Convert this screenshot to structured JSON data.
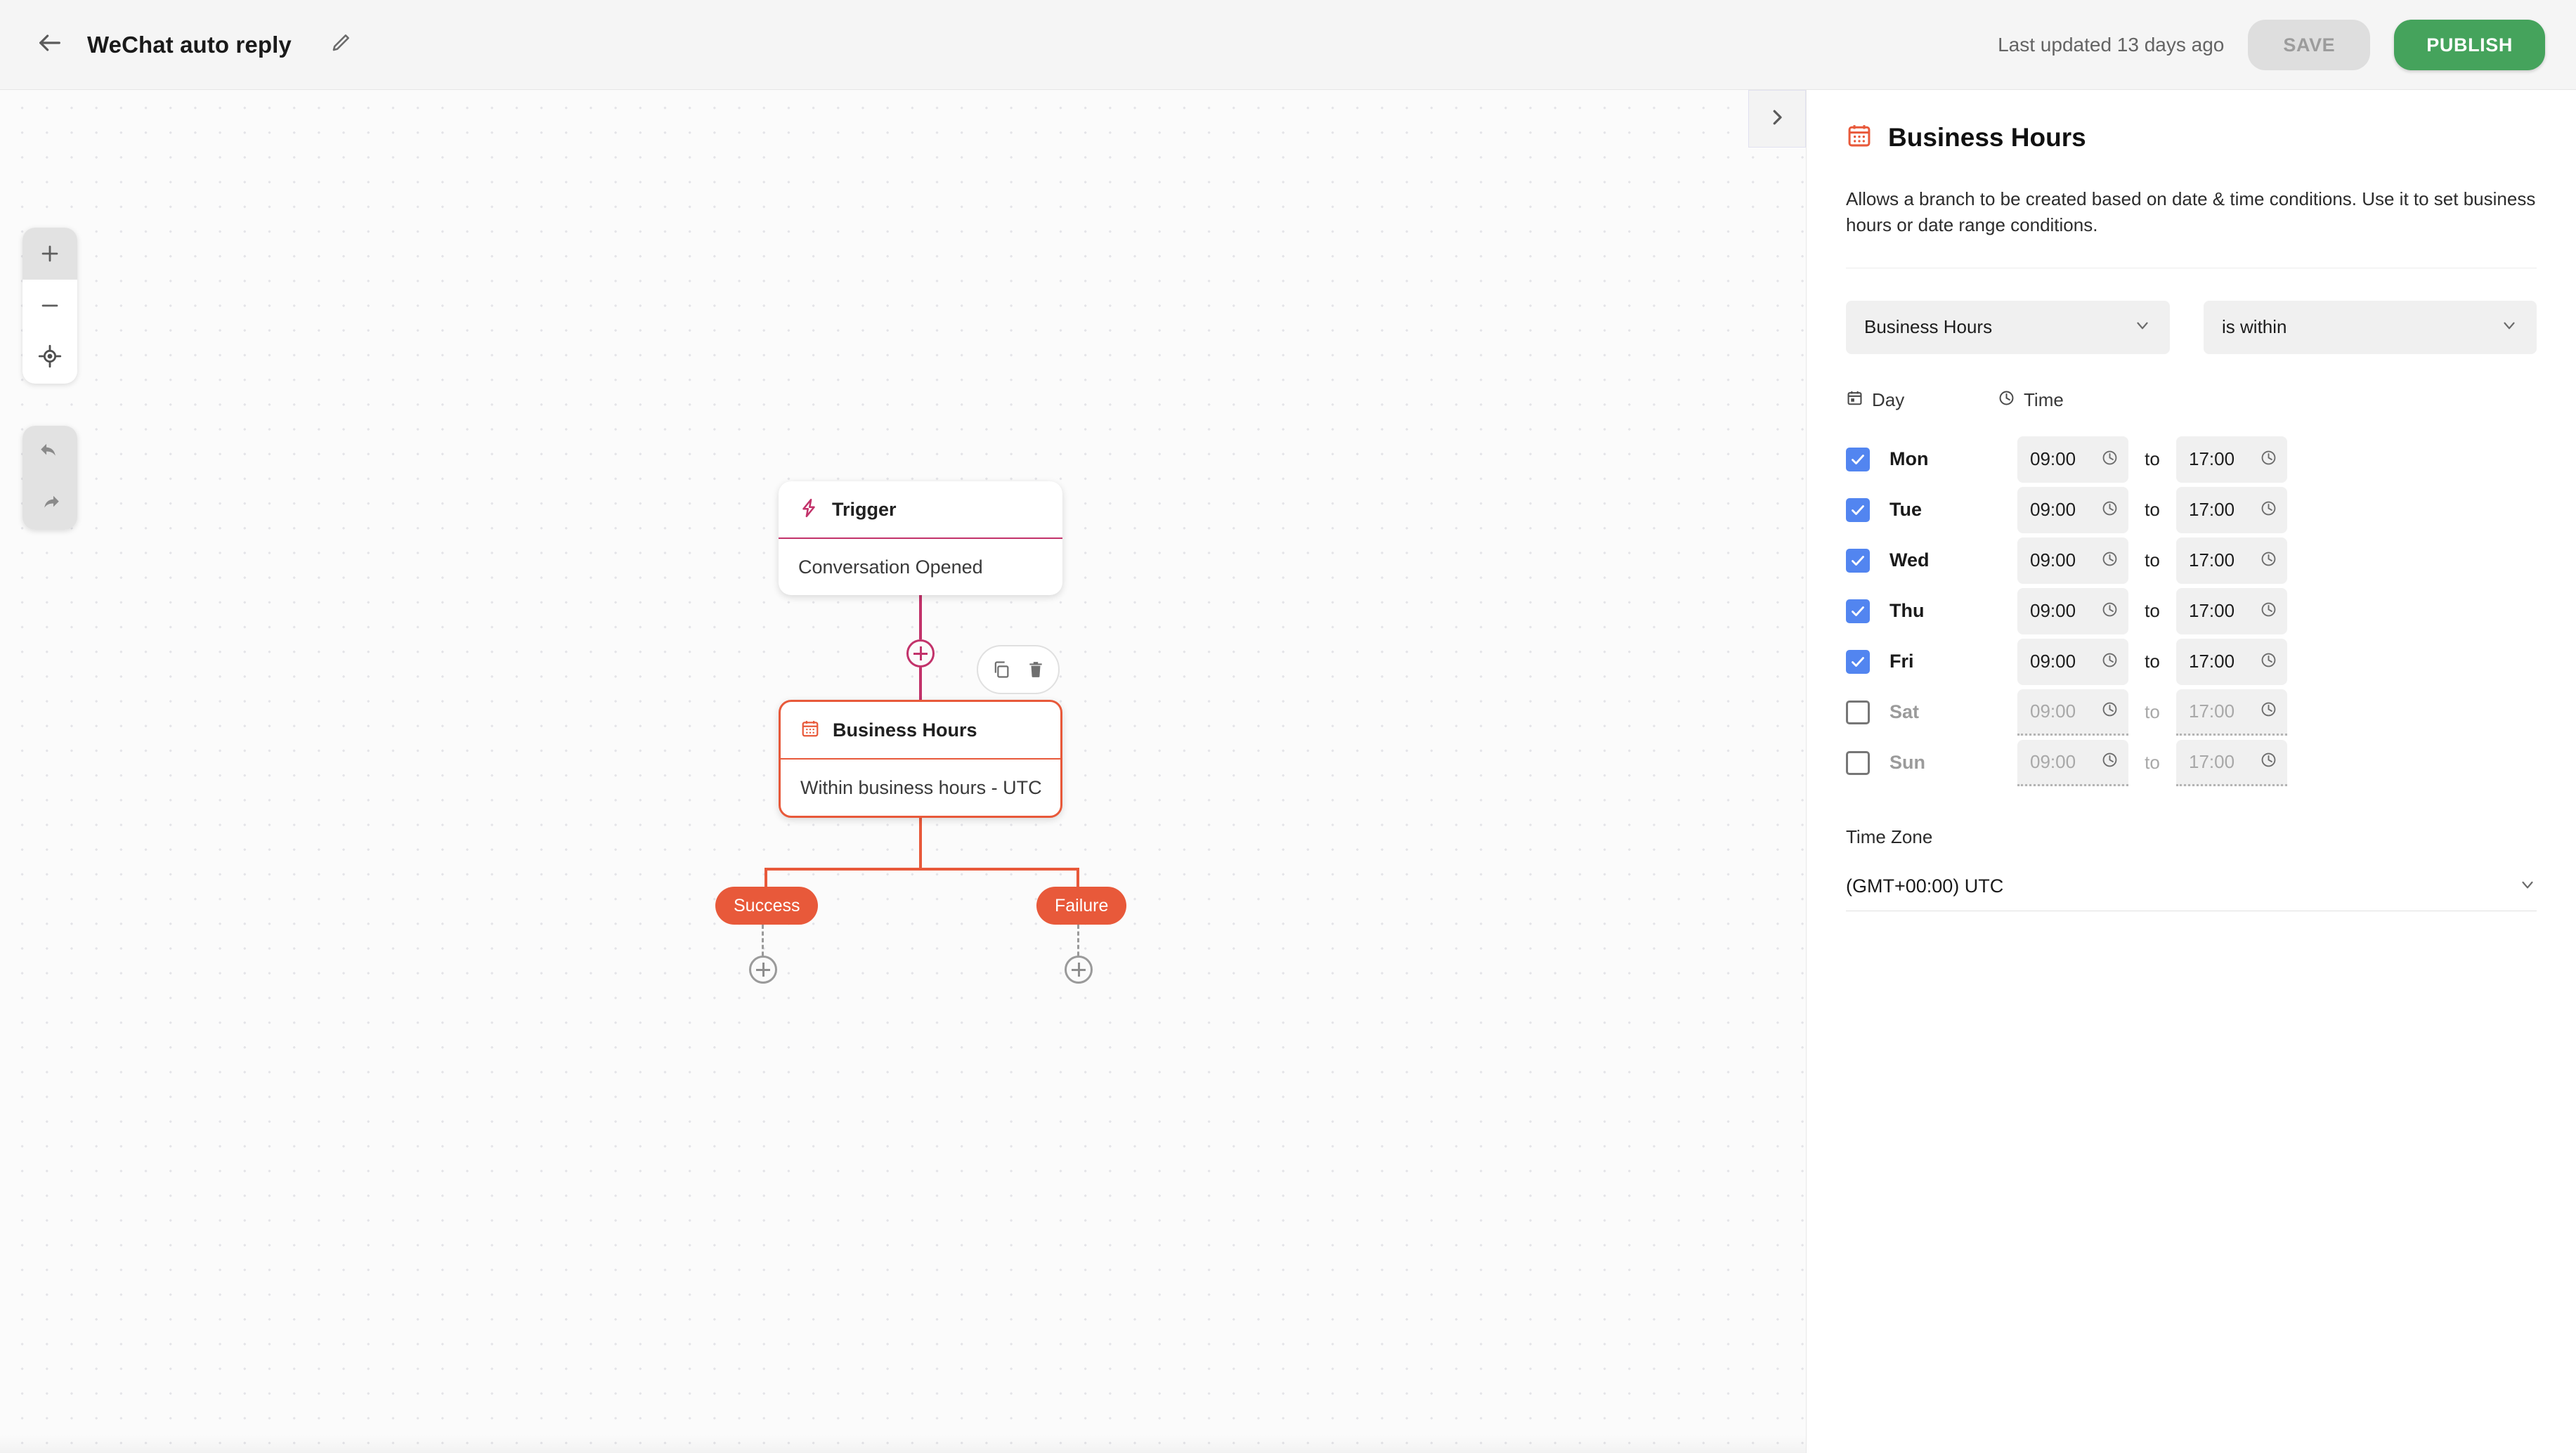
{
  "topbar": {
    "back_icon": "arrow-left-icon",
    "title": "WeChat auto reply",
    "edit_icon": "pencil-icon",
    "last_updated": "Last updated 13 days ago",
    "save_label": "SAVE",
    "publish_label": "PUBLISH",
    "colors": {
      "publish_green": "#45a35c",
      "save_grey": "#dedede"
    }
  },
  "canvas": {
    "controls": {
      "zoom_in": "+",
      "zoom_out": "−",
      "recenter_icon": "crosshair-icon",
      "undo_icon": "undo-icon",
      "redo_icon": "redo-icon"
    },
    "panel_handle_icon": "chevron-right-icon",
    "nodes": [
      {
        "id": "trigger",
        "icon": "lightning-bolt-icon",
        "title": "Trigger",
        "body": "Conversation Opened",
        "accent": "#c2326a"
      },
      {
        "id": "business-hours",
        "icon": "calendar-icon",
        "title": "Business Hours",
        "body": "Within business hours - UTC",
        "accent": "#e8593a",
        "selected": true
      }
    ],
    "node_toolbar": {
      "duplicate_icon": "copy-icon",
      "delete_icon": "trash-icon"
    },
    "branches": [
      {
        "label": "Success"
      },
      {
        "label": "Failure"
      }
    ],
    "add_step_icon": "plus-circle-icon"
  },
  "panel": {
    "icon": "calendar-icon",
    "title": "Business Hours",
    "description": "Allows a branch to be created based on date & time conditions. Use it to set business hours or date range conditions.",
    "condition_select": {
      "value": "Business Hours",
      "chevron": "chevron-down-icon"
    },
    "operator_select": {
      "value": "is within",
      "chevron": "chevron-down-icon"
    },
    "table_headers": {
      "day": {
        "label": "Day",
        "icon": "calendar-small-icon"
      },
      "time": {
        "label": "Time",
        "icon": "clock-icon"
      }
    },
    "to_word": "to",
    "clock_icon": "clock-icon",
    "days": [
      {
        "name": "Mon",
        "checked": true,
        "from": "09:00",
        "to": "17:00"
      },
      {
        "name": "Tue",
        "checked": true,
        "from": "09:00",
        "to": "17:00"
      },
      {
        "name": "Wed",
        "checked": true,
        "from": "09:00",
        "to": "17:00"
      },
      {
        "name": "Thu",
        "checked": true,
        "from": "09:00",
        "to": "17:00"
      },
      {
        "name": "Fri",
        "checked": true,
        "from": "09:00",
        "to": "17:00"
      },
      {
        "name": "Sat",
        "checked": false,
        "from": "09:00",
        "to": "17:00"
      },
      {
        "name": "Sun",
        "checked": false,
        "from": "09:00",
        "to": "17:00"
      }
    ],
    "timezone": {
      "label": "Time Zone",
      "value": "(GMT+00:00) UTC",
      "chevron": "chevron-down-icon"
    }
  }
}
